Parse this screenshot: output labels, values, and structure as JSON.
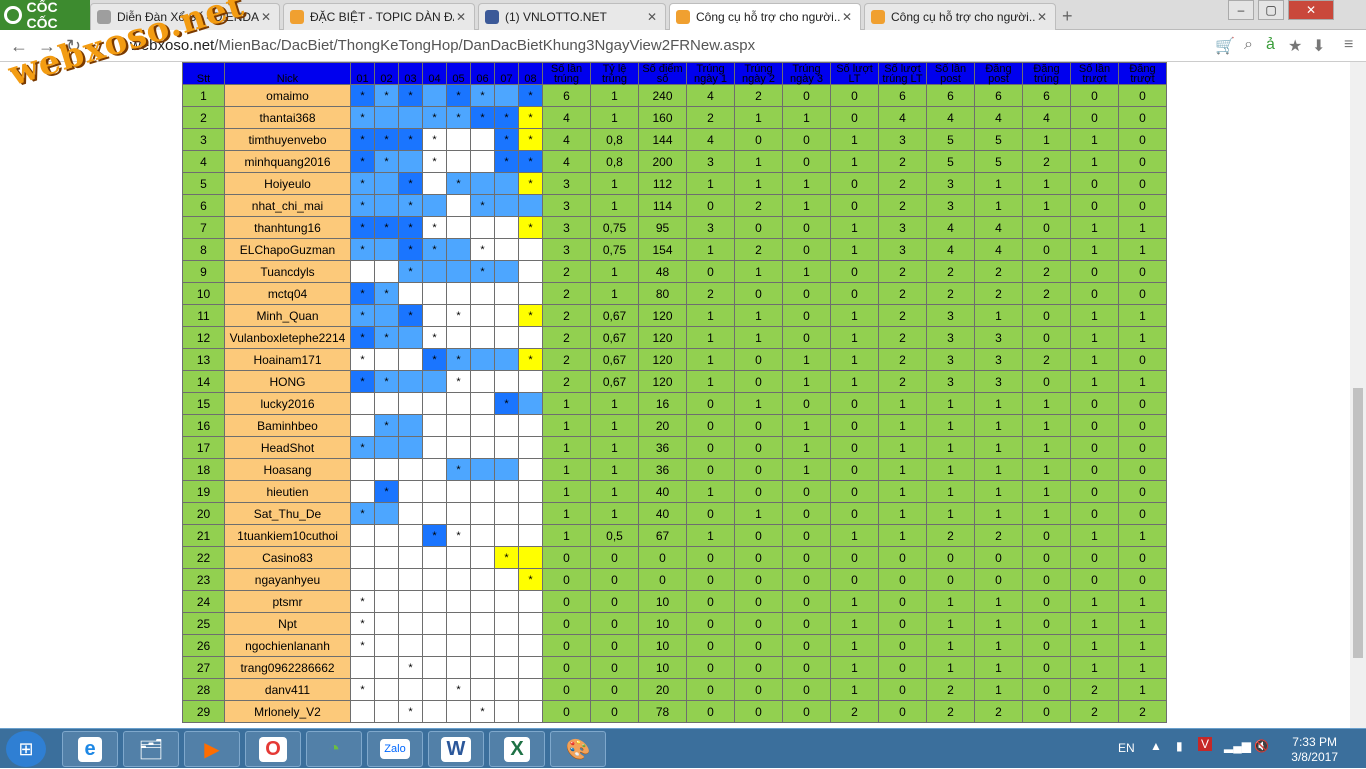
{
  "browser": {
    "brand": "CỐC CỐC",
    "tabs": [
      {
        "label": "Diễn Đàn Xổ Số - DIENDAN...",
        "icon": "page-icon",
        "active": false
      },
      {
        "label": "ĐẶC BIỆT - TOPIC DÀN ĐẶ...",
        "icon": "xs-icon",
        "active": false
      },
      {
        "label": "(1) VNLOTTO.NET",
        "icon": "facebook-icon",
        "active": false
      },
      {
        "label": "Công cụ hỗ trợ cho người...",
        "icon": "xs-icon",
        "active": true
      },
      {
        "label": "Công cụ hỗ trợ cho người...",
        "icon": "xs-icon",
        "active": false
      }
    ],
    "url_host": "webxoso.net",
    "url_path": "/MienBac/DacBiet/ThongKeTongHop/DanDacBietKhung3NgayView2FRNew.aspx"
  },
  "watermark": "webxoso.net",
  "table": {
    "headers": [
      "Stt",
      "Nick",
      "01",
      "02",
      "03",
      "04",
      "05",
      "06",
      "07",
      "08",
      "Số lần trúng",
      "Tỷ lệ trúng",
      "Số điểm số",
      "Trúng ngày 1",
      "Trúng ngày 2",
      "Trúng ngày 3",
      "Số lượt LT",
      "Số lượt trúng LT",
      "Số lần post",
      "Đăng post",
      "Đăng trúng",
      "Số lần trượt",
      "Đăng trượt"
    ],
    "rows": [
      {
        "stt": "1",
        "nick": "omaimo",
        "m": [
          "*",
          "*",
          "*",
          "",
          "*",
          "*",
          "",
          "*"
        ],
        "c": [
          2,
          1,
          2,
          1,
          2,
          1,
          1,
          2
        ],
        "n": [
          "6",
          "1",
          "240",
          "4",
          "2",
          "0",
          "0",
          "6",
          "6",
          "6",
          "6",
          "0",
          "0"
        ]
      },
      {
        "stt": "2",
        "nick": "thantai368",
        "m": [
          "*",
          "",
          "",
          "*",
          "*",
          "*",
          "*",
          "*"
        ],
        "c": [
          1,
          1,
          1,
          1,
          1,
          2,
          2,
          3
        ],
        "n": [
          "4",
          "1",
          "160",
          "2",
          "1",
          "1",
          "0",
          "4",
          "4",
          "4",
          "4",
          "0",
          "0"
        ]
      },
      {
        "stt": "3",
        "nick": "timthuyenvebo",
        "m": [
          "*",
          "*",
          "*",
          "*",
          "",
          "",
          "*",
          "*"
        ],
        "c": [
          2,
          2,
          2,
          0,
          0,
          0,
          2,
          3
        ],
        "n": [
          "4",
          "0,8",
          "144",
          "4",
          "0",
          "0",
          "1",
          "3",
          "5",
          "5",
          "1",
          "1",
          "0"
        ]
      },
      {
        "stt": "4",
        "nick": "minhquang2016",
        "m": [
          "*",
          "*",
          "",
          "*",
          "",
          "",
          "*",
          "*"
        ],
        "c": [
          2,
          1,
          1,
          0,
          0,
          0,
          2,
          2
        ],
        "n": [
          "4",
          "0,8",
          "200",
          "3",
          "1",
          "0",
          "1",
          "2",
          "5",
          "5",
          "2",
          "1",
          "0"
        ]
      },
      {
        "stt": "5",
        "nick": "Hoiyeulo",
        "m": [
          "*",
          "",
          "*",
          "",
          "*",
          "",
          "",
          "*"
        ],
        "c": [
          1,
          1,
          2,
          0,
          1,
          1,
          1,
          3
        ],
        "n": [
          "3",
          "1",
          "112",
          "1",
          "1",
          "1",
          "0",
          "2",
          "3",
          "1",
          "1",
          "0",
          "0"
        ]
      },
      {
        "stt": "6",
        "nick": "nhat_chi_mai",
        "m": [
          "*",
          "",
          "*",
          "",
          "",
          "*",
          "",
          ""
        ],
        "c": [
          1,
          1,
          1,
          1,
          0,
          1,
          1,
          1
        ],
        "n": [
          "3",
          "1",
          "114",
          "0",
          "2",
          "1",
          "0",
          "2",
          "3",
          "1",
          "1",
          "0",
          "0"
        ]
      },
      {
        "stt": "7",
        "nick": "thanhtung16",
        "m": [
          "*",
          "*",
          "*",
          "*",
          "",
          "",
          "",
          "*"
        ],
        "c": [
          2,
          2,
          2,
          0,
          0,
          0,
          0,
          3
        ],
        "n": [
          "3",
          "0,75",
          "95",
          "3",
          "0",
          "0",
          "1",
          "3",
          "4",
          "4",
          "0",
          "1",
          "1"
        ]
      },
      {
        "stt": "8",
        "nick": "ELChapoGuzman",
        "m": [
          "*",
          "",
          "*",
          "*",
          "",
          "*",
          "",
          ""
        ],
        "c": [
          1,
          1,
          2,
          1,
          1,
          0,
          0,
          0
        ],
        "n": [
          "3",
          "0,75",
          "154",
          "1",
          "2",
          "0",
          "1",
          "3",
          "4",
          "4",
          "0",
          "1",
          "1"
        ]
      },
      {
        "stt": "9",
        "nick": "Tuancdyls",
        "m": [
          "",
          "",
          "*",
          "",
          "",
          "*",
          "",
          ""
        ],
        "c": [
          0,
          0,
          1,
          1,
          1,
          1,
          1,
          0
        ],
        "n": [
          "2",
          "1",
          "48",
          "0",
          "1",
          "1",
          "0",
          "2",
          "2",
          "2",
          "2",
          "0",
          "0"
        ]
      },
      {
        "stt": "10",
        "nick": "mctq04",
        "m": [
          "*",
          "*",
          "",
          "",
          "",
          "",
          "",
          ""
        ],
        "c": [
          2,
          1,
          0,
          0,
          0,
          0,
          0,
          0
        ],
        "n": [
          "2",
          "1",
          "80",
          "2",
          "0",
          "0",
          "0",
          "2",
          "2",
          "2",
          "2",
          "0",
          "0"
        ]
      },
      {
        "stt": "11",
        "nick": "Minh_Quan",
        "m": [
          "*",
          "",
          "*",
          "",
          "*",
          "",
          "",
          "*"
        ],
        "c": [
          1,
          1,
          2,
          0,
          0,
          0,
          0,
          3
        ],
        "n": [
          "2",
          "0,67",
          "120",
          "1",
          "1",
          "0",
          "1",
          "2",
          "3",
          "1",
          "0",
          "1",
          "1"
        ]
      },
      {
        "stt": "12",
        "nick": "Vulanboxletephe2214",
        "m": [
          "*",
          "*",
          "",
          "*",
          "",
          "",
          "",
          ""
        ],
        "c": [
          2,
          1,
          1,
          0,
          0,
          0,
          0,
          0
        ],
        "n": [
          "2",
          "0,67",
          "120",
          "1",
          "1",
          "0",
          "1",
          "2",
          "3",
          "3",
          "0",
          "1",
          "1"
        ]
      },
      {
        "stt": "13",
        "nick": "Hoainam171",
        "m": [
          "*",
          "",
          "",
          "*",
          "*",
          "",
          "",
          "*"
        ],
        "c": [
          0,
          0,
          0,
          2,
          1,
          1,
          1,
          3
        ],
        "n": [
          "2",
          "0,67",
          "120",
          "1",
          "0",
          "1",
          "1",
          "2",
          "3",
          "3",
          "2",
          "1",
          "0"
        ]
      },
      {
        "stt": "14",
        "nick": "HONG",
        "m": [
          "*",
          "*",
          "",
          "",
          "*",
          "",
          "",
          ""
        ],
        "c": [
          2,
          1,
          1,
          1,
          0,
          0,
          0,
          0
        ],
        "n": [
          "2",
          "0,67",
          "120",
          "1",
          "0",
          "1",
          "1",
          "2",
          "3",
          "3",
          "0",
          "1",
          "1"
        ]
      },
      {
        "stt": "15",
        "nick": "lucky2016",
        "m": [
          "",
          "",
          "",
          "",
          "",
          "",
          "*",
          ""
        ],
        "c": [
          0,
          0,
          0,
          0,
          0,
          0,
          2,
          1
        ],
        "n": [
          "1",
          "1",
          "16",
          "0",
          "1",
          "0",
          "0",
          "1",
          "1",
          "1",
          "1",
          "0",
          "0"
        ]
      },
      {
        "stt": "16",
        "nick": "Baminhbeo",
        "m": [
          "",
          "*",
          "",
          "",
          "",
          "",
          "",
          ""
        ],
        "c": [
          0,
          1,
          1,
          0,
          0,
          0,
          0,
          0
        ],
        "n": [
          "1",
          "1",
          "20",
          "0",
          "0",
          "1",
          "0",
          "1",
          "1",
          "1",
          "1",
          "0",
          "0"
        ]
      },
      {
        "stt": "17",
        "nick": "HeadShot",
        "m": [
          "*",
          "",
          "",
          "",
          "",
          "",
          "",
          ""
        ],
        "c": [
          1,
          1,
          1,
          0,
          0,
          0,
          0,
          0
        ],
        "n": [
          "1",
          "1",
          "36",
          "0",
          "0",
          "1",
          "0",
          "1",
          "1",
          "1",
          "1",
          "0",
          "0"
        ]
      },
      {
        "stt": "18",
        "nick": "Hoasang",
        "m": [
          "",
          "",
          "",
          "",
          "*",
          "",
          "",
          ""
        ],
        "c": [
          0,
          0,
          0,
          0,
          1,
          1,
          1,
          0
        ],
        "n": [
          "1",
          "1",
          "36",
          "0",
          "0",
          "1",
          "0",
          "1",
          "1",
          "1",
          "1",
          "0",
          "0"
        ]
      },
      {
        "stt": "19",
        "nick": "hieutien",
        "m": [
          "",
          "*",
          "",
          "",
          "",
          "",
          "",
          ""
        ],
        "c": [
          0,
          2,
          0,
          0,
          0,
          0,
          0,
          0
        ],
        "n": [
          "1",
          "1",
          "40",
          "1",
          "0",
          "0",
          "0",
          "1",
          "1",
          "1",
          "1",
          "0",
          "0"
        ]
      },
      {
        "stt": "20",
        "nick": "Sat_Thu_De",
        "m": [
          "*",
          "",
          "",
          "",
          "",
          "",
          "",
          ""
        ],
        "c": [
          1,
          1,
          0,
          0,
          0,
          0,
          0,
          0
        ],
        "n": [
          "1",
          "1",
          "40",
          "0",
          "1",
          "0",
          "0",
          "1",
          "1",
          "1",
          "1",
          "0",
          "0"
        ]
      },
      {
        "stt": "21",
        "nick": "1tuankiem10cuthoi",
        "m": [
          "",
          "",
          "",
          "*",
          "*",
          "",
          "",
          ""
        ],
        "c": [
          0,
          0,
          0,
          2,
          0,
          0,
          0,
          0
        ],
        "n": [
          "1",
          "0,5",
          "67",
          "1",
          "0",
          "0",
          "1",
          "1",
          "2",
          "2",
          "0",
          "1",
          "1"
        ]
      },
      {
        "stt": "22",
        "nick": "Casino83",
        "m": [
          "",
          "",
          "",
          "",
          "",
          "",
          "*",
          ""
        ],
        "c": [
          0,
          0,
          0,
          0,
          0,
          0,
          3,
          3
        ],
        "n": [
          "0",
          "0",
          "0",
          "0",
          "0",
          "0",
          "0",
          "0",
          "0",
          "0",
          "0",
          "0",
          "0"
        ]
      },
      {
        "stt": "23",
        "nick": "ngayanhyeu",
        "m": [
          "",
          "",
          "",
          "",
          "",
          "",
          "",
          "*"
        ],
        "c": [
          0,
          0,
          0,
          0,
          0,
          0,
          0,
          3
        ],
        "n": [
          "0",
          "0",
          "0",
          "0",
          "0",
          "0",
          "0",
          "0",
          "0",
          "0",
          "0",
          "0",
          "0"
        ]
      },
      {
        "stt": "24",
        "nick": "ptsmr",
        "m": [
          "*",
          "",
          "",
          "",
          "",
          "",
          "",
          ""
        ],
        "c": [
          0,
          0,
          0,
          0,
          0,
          0,
          0,
          0
        ],
        "n": [
          "0",
          "0",
          "10",
          "0",
          "0",
          "0",
          "1",
          "0",
          "1",
          "1",
          "0",
          "1",
          "1"
        ]
      },
      {
        "stt": "25",
        "nick": "Npt",
        "m": [
          "*",
          "",
          "",
          "",
          "",
          "",
          "",
          ""
        ],
        "c": [
          0,
          0,
          0,
          0,
          0,
          0,
          0,
          0
        ],
        "n": [
          "0",
          "0",
          "10",
          "0",
          "0",
          "0",
          "1",
          "0",
          "1",
          "1",
          "0",
          "1",
          "1"
        ]
      },
      {
        "stt": "26",
        "nick": "ngochienlananh",
        "m": [
          "*",
          "",
          "",
          "",
          "",
          "",
          "",
          ""
        ],
        "c": [
          0,
          0,
          0,
          0,
          0,
          0,
          0,
          0
        ],
        "n": [
          "0",
          "0",
          "10",
          "0",
          "0",
          "0",
          "1",
          "0",
          "1",
          "1",
          "0",
          "1",
          "1"
        ]
      },
      {
        "stt": "27",
        "nick": "trang0962286662",
        "m": [
          "",
          "",
          "*",
          "",
          "",
          "",
          "",
          ""
        ],
        "c": [
          0,
          0,
          0,
          0,
          0,
          0,
          0,
          0
        ],
        "n": [
          "0",
          "0",
          "10",
          "0",
          "0",
          "0",
          "1",
          "0",
          "1",
          "1",
          "0",
          "1",
          "1"
        ]
      },
      {
        "stt": "28",
        "nick": "danv411",
        "m": [
          "*",
          "",
          "",
          "",
          "*",
          "",
          "",
          ""
        ],
        "c": [
          0,
          0,
          0,
          0,
          0,
          0,
          0,
          0
        ],
        "n": [
          "0",
          "0",
          "20",
          "0",
          "0",
          "0",
          "1",
          "0",
          "2",
          "1",
          "0",
          "2",
          "1"
        ]
      },
      {
        "stt": "29",
        "nick": "Mrlonely_V2",
        "m": [
          "",
          "",
          "*",
          "",
          "",
          "*",
          "",
          ""
        ],
        "c": [
          0,
          0,
          0,
          0,
          0,
          0,
          0,
          0
        ],
        "n": [
          "0",
          "0",
          "78",
          "0",
          "0",
          "0",
          "2",
          "0",
          "2",
          "2",
          "0",
          "2",
          "2"
        ]
      }
    ]
  },
  "taskbar": {
    "apps": [
      "explorer-icon",
      "ie-icon",
      "folder-icon",
      "media-icon",
      "opera-icon",
      "coccoc-icon",
      "zalo-icon",
      "word-icon",
      "excel-icon",
      "paint-icon"
    ],
    "zalo_label": "Zalo",
    "lang": "EN",
    "time": "7:33 PM",
    "date": "3/8/2017"
  },
  "colors": {
    "stt_bg": "#92d050",
    "nick_bg": "#fcc97a",
    "header_bg": "#0000ee",
    "light_blue": "#4da6ff",
    "dark_blue": "#1a75ff",
    "yellow": "#ffff00"
  }
}
